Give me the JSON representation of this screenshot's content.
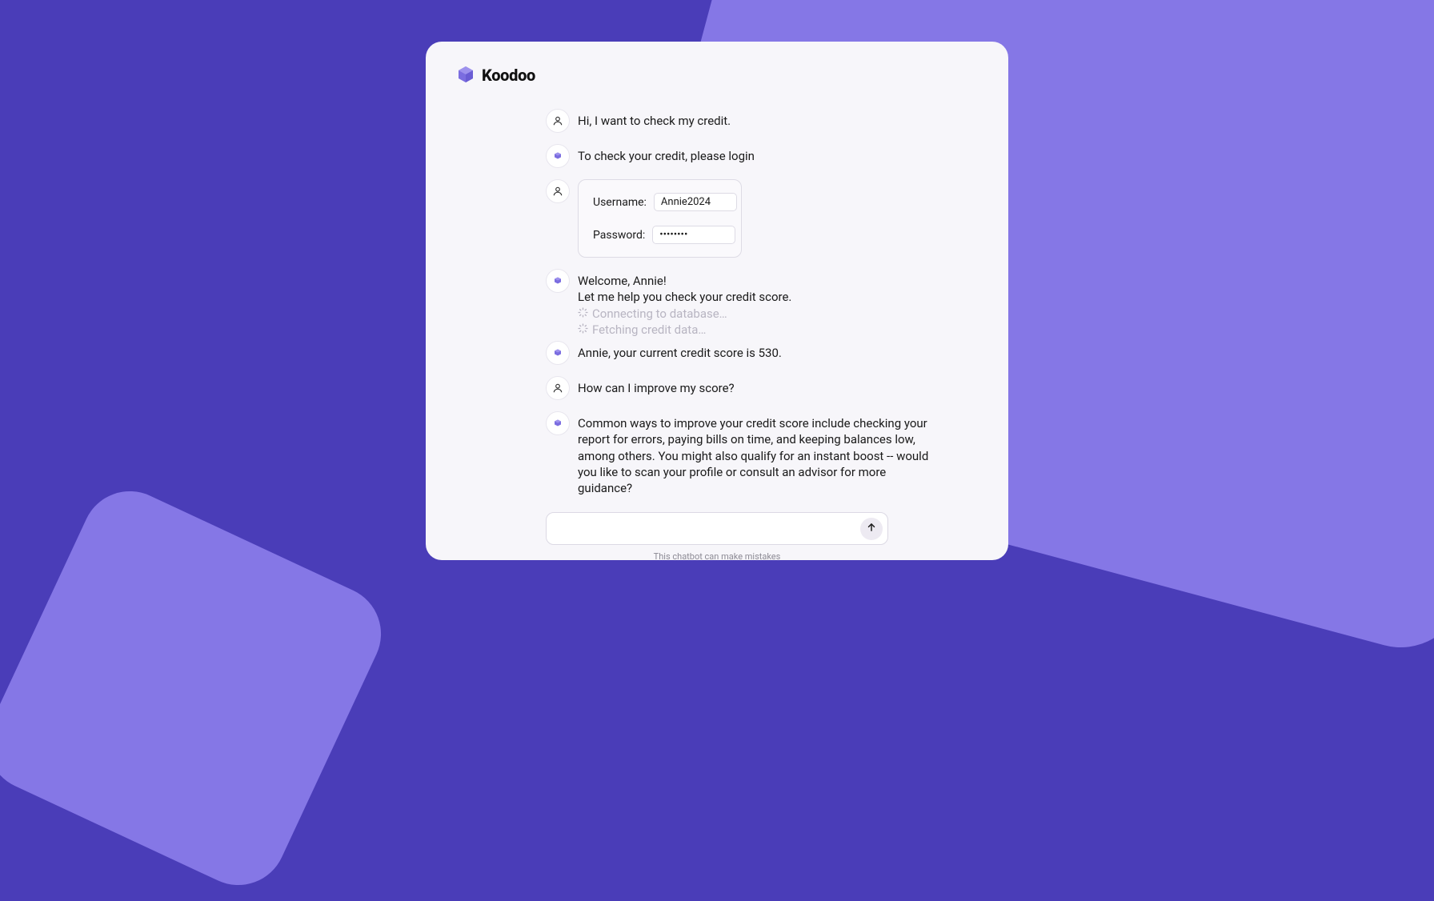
{
  "brand": {
    "name": "Koodoo"
  },
  "messages": {
    "m1": "Hi, I want to check my credit.",
    "m2": "To check your credit, please login",
    "m3_line1": "Welcome, Annie!",
    "m3_line2": "Let me help you check your credit score.",
    "m3_status1": "Connecting to database…",
    "m3_status2": "Fetching credit data…",
    "m4": "Annie, your current credit score is 530.",
    "m5": "How can I improve my score?",
    "m6": "Common ways to improve your credit score include checking your report for errors, paying bills on time, and keeping balances low, among others. You might also qualify for an instant boost -- would you like to scan your profile or consult an advisor for more guidance?"
  },
  "login": {
    "username_label": "Username:",
    "username_value": "Annie2024",
    "password_label": "Password:",
    "password_value": "••••••••"
  },
  "input": {
    "placeholder": ""
  },
  "disclaimer": "This chatbot can make mistakes"
}
